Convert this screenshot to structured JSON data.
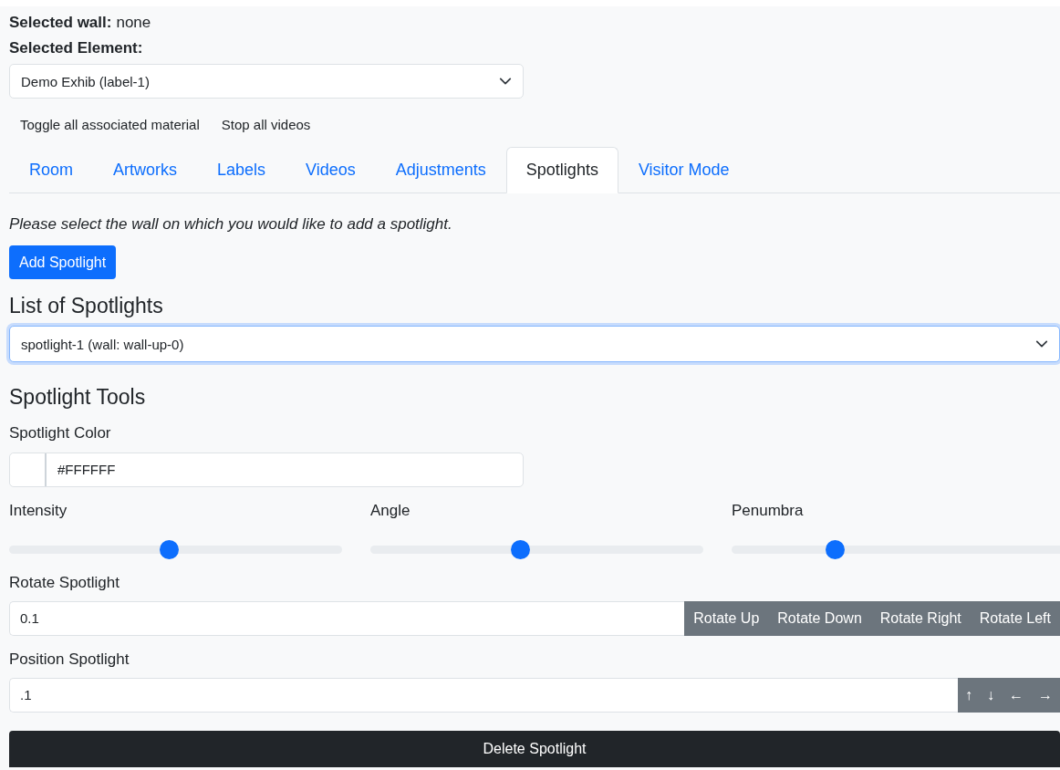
{
  "selected_wall": {
    "label": "Selected wall:",
    "value": "none"
  },
  "selected_element": {
    "label": "Selected Element:",
    "value": "Demo Exhib (label-1)"
  },
  "actions": [
    "Toggle all associated material",
    "Stop all videos"
  ],
  "tabs": [
    {
      "label": "Room",
      "selected": false
    },
    {
      "label": "Artworks",
      "selected": false
    },
    {
      "label": "Labels",
      "selected": false
    },
    {
      "label": "Videos",
      "selected": false
    },
    {
      "label": "Adjustments",
      "selected": false
    },
    {
      "label": "Spotlights",
      "selected": true
    },
    {
      "label": "Visitor Mode",
      "selected": false
    }
  ],
  "hint": "Please select the wall on which you would like to add a spotlight.",
  "add_button": "Add Spotlight",
  "list": {
    "heading": "List of Spotlights",
    "value": "spotlight-1 (wall: wall-up-0)",
    "focused": true
  },
  "tools": {
    "heading": "Spotlight Tools",
    "color_label": "Spotlight Color",
    "color_value": "#FFFFFF"
  },
  "sliders": [
    {
      "label": "Intensity",
      "level": 0.48
    },
    {
      "label": "Angle",
      "level": 0.45
    },
    {
      "label": "Penumbra",
      "level": 0.31
    }
  ],
  "rotate": {
    "label": "Rotate Spotlight",
    "value": "0.1",
    "buttons": [
      "Rotate Up",
      "Rotate Down",
      "Rotate Right",
      "Rotate Left"
    ]
  },
  "position": {
    "label": "Position Spotlight",
    "value": ".1",
    "buttons": [
      "↑",
      "↓",
      "←",
      "→"
    ]
  },
  "delete_button": "Delete Spotlight"
}
